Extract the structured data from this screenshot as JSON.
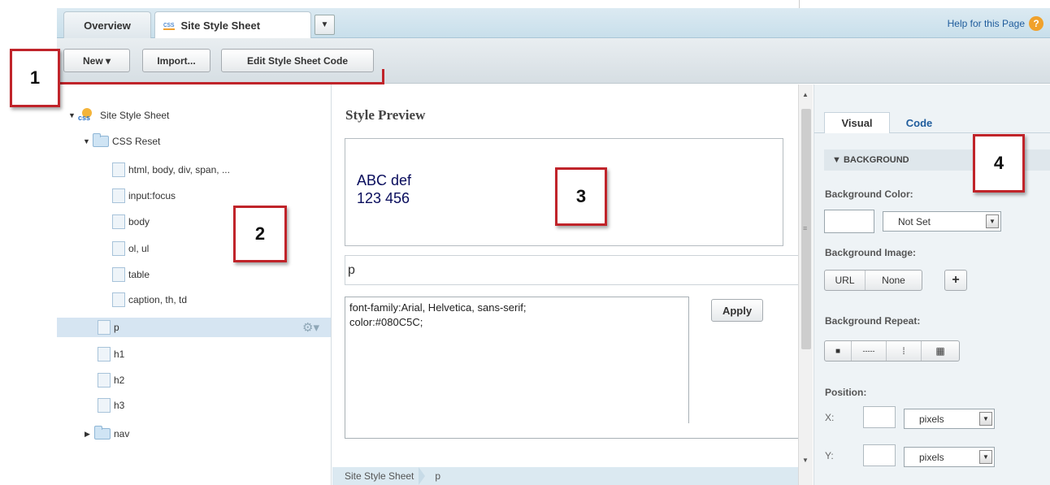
{
  "tabs": {
    "overview": "Overview",
    "site_icon": "css",
    "site_label": "Site Style Sheet",
    "dropdown": "▼"
  },
  "help": {
    "label": "Help for this Page",
    "icon": "?"
  },
  "toolbar": {
    "new_label": "New ▾",
    "import_label": "Import...",
    "edit_label": "Edit Style Sheet Code"
  },
  "tree": {
    "root": {
      "label": "Site Style Sheet",
      "icon_text": "css"
    },
    "folder_css_reset": "CSS Reset",
    "css_reset_items": [
      "html, body, div, span, ...",
      "input:focus",
      "body",
      "ol, ul",
      "table",
      "caption, th, td"
    ],
    "selected": "p",
    "others": [
      "h1",
      "h2",
      "h3"
    ],
    "folder_nav": "nav"
  },
  "preview": {
    "title": "Style Preview",
    "line1": "ABC def",
    "line2": "123 456"
  },
  "selector": "p",
  "code": {
    "line1": "font-family:Arial, Helvetica, sans-serif;",
    "line2": "color:#080C5C;"
  },
  "apply_label": "Apply",
  "breadcrumb": [
    "Site Style Sheet",
    "p"
  ],
  "right_panel": {
    "tab_visual": "Visual",
    "tab_code": "Code",
    "section": "▼ BACKGROUND",
    "bg_color_label": "Background Color:",
    "bg_color_value": "Not Set",
    "bg_image_label": "Background Image:",
    "url_label": "URL",
    "none_label": "None",
    "plus_label": "+",
    "repeat_label": "Background Repeat:",
    "repeat_options": [
      "■",
      "-----",
      "⁞",
      "▦"
    ],
    "position_label": "Position:",
    "x_label": "X:",
    "y_label": "Y:",
    "x_unit": "pixels",
    "y_unit": "pixels"
  },
  "callouts": [
    "1",
    "2",
    "3",
    "4"
  ],
  "colors": {
    "accent": "#c0242a",
    "preview_text": "#080c5c",
    "link": "#1f5c9c"
  }
}
